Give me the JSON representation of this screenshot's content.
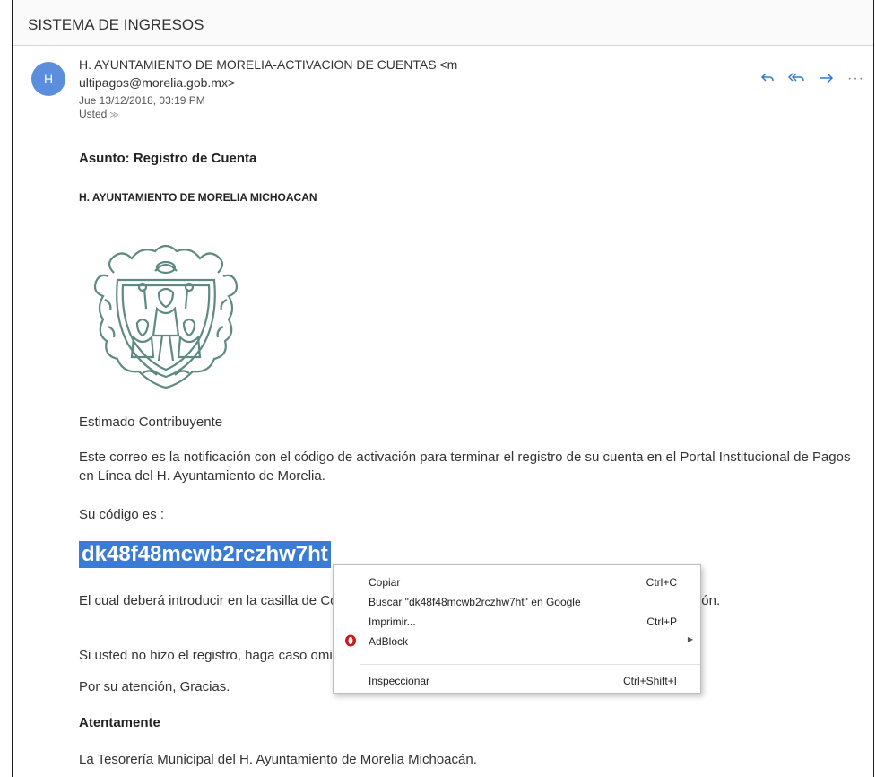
{
  "folder": {
    "title": "SISTEMA DE INGRESOS"
  },
  "email": {
    "avatar_letter": "H",
    "sender_line1": "H. AYUNTAMIENTO DE MORELIA-ACTIVACION DE CUENTAS <m",
    "sender_line2": "ultipagos@morelia.gob.mx>",
    "date": "Jue 13/12/2018, 03:19 PM",
    "recipient": "Usted",
    "subject": "Asunto: Registro de Cuenta",
    "org_name": "H. AYUNTAMIENTO DE MORELIA MICHOACAN",
    "greeting": "Estimado Contribuyente",
    "notification": "Este correo es la notificación con el código de activación para terminar el registro de su cuenta en el Portal Institucional de Pagos en Línea del H. Ayuntamiento de Morelia.",
    "code_intro": "Su código es :",
    "code": "dk48f48mcwb2rczhw7ht",
    "instructions": "El cual deberá introducir en la casilla de Código de activación en la sección de Validar código de activación.",
    "ignore_note": "Si usted no hizo el registro, haga caso omiso de este correo.",
    "thanks": "Por su atención, Gracias.",
    "closing": "Atentamente",
    "signature": "La Tesorería Municipal del H. Ayuntamiento de Morelia Michoacán."
  },
  "actions": {
    "reply_icon": "reply-icon",
    "reply_all_icon": "reply-all-icon",
    "forward_icon": "forward-icon",
    "more_icon": "more-icon"
  },
  "context_menu": {
    "items": [
      {
        "label": "Copiar",
        "shortcut": "Ctrl+C"
      },
      {
        "label": "Buscar \"dk48f48mcwb2rczhw7ht\" en Google",
        "shortcut": ""
      },
      {
        "label": "Imprimir...",
        "shortcut": "Ctrl+P"
      },
      {
        "label": "AdBlock",
        "shortcut": "",
        "icon": "opera-icon",
        "submenu": true
      },
      {
        "label": "Inspeccionar",
        "shortcut": "Ctrl+Shift+I"
      }
    ]
  },
  "colors": {
    "accent": "#2e78d6",
    "selection": "#3a7bd5",
    "avatar": "#5b8fde",
    "seal": "#5e8a82"
  }
}
